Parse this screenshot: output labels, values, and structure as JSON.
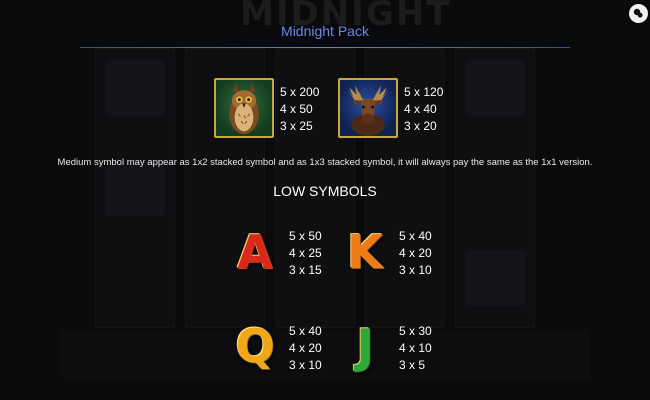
{
  "header": {
    "title": "Midnight Pack"
  },
  "background": {
    "game_title": "MIDNIGHT"
  },
  "controls": {
    "close_icon": "close-icon"
  },
  "medium_symbols": [
    {
      "icon": "owl-icon",
      "payouts": [
        "5 x 200",
        "4 x 50",
        "3 x 25"
      ]
    },
    {
      "icon": "moose-icon",
      "payouts": [
        "5 x 120",
        "4 x 40",
        "3 x 20"
      ]
    }
  ],
  "note": "Medium symbol may appear as 1x2 stacked symbol and as 1x3 stacked symbol, it will always pay the same as the 1x1 version.",
  "low_symbols": {
    "heading": "LOW SYMBOLS",
    "items": [
      {
        "letter": "A",
        "color": "#d9291d",
        "payouts": [
          "5 x 50",
          "4 x 25",
          "3 x 15"
        ]
      },
      {
        "letter": "K",
        "color": "#ef7a16",
        "payouts": [
          "5 x 40",
          "4 x 20",
          "3 x 10"
        ]
      },
      {
        "letter": "Q",
        "color": "#f0a81a",
        "payouts": [
          "5 x 40",
          "4 x 20",
          "3 x 10"
        ]
      },
      {
        "letter": "J",
        "color": "#2fa83a",
        "payouts": [
          "5 x 30",
          "4 x 10",
          "3 x 5"
        ]
      }
    ]
  },
  "colors": {
    "title": "#6e86e6",
    "frame_gold": "#c9a93e"
  }
}
